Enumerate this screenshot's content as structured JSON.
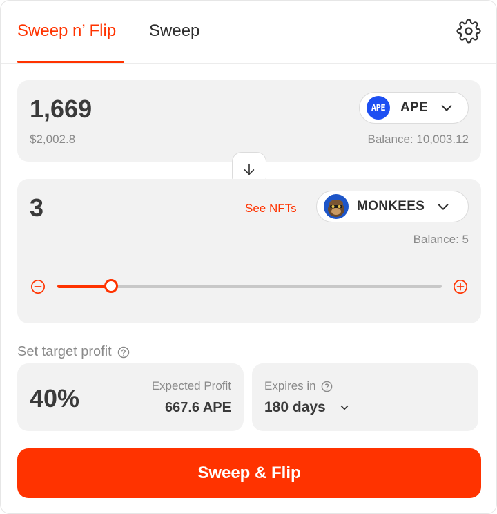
{
  "tabs": [
    {
      "label": "Sweep n’ Flip",
      "active": true
    },
    {
      "label": "Sweep",
      "active": false
    }
  ],
  "pay": {
    "amount": "1,669",
    "fiat": "$2,002.8",
    "token_symbol": "APE",
    "token_logo_text": "APE",
    "balance": "Balance: 10,003.12"
  },
  "receive": {
    "amount": "3",
    "see_nfts_label": "See NFTs",
    "token_symbol": "MONKEES",
    "balance": "Balance: 5",
    "slider_fraction": 0.14
  },
  "profit": {
    "section_label": "Set target profit",
    "percent": "40%",
    "expected_label": "Expected Profit",
    "expected_value": "667.6 APE"
  },
  "expiry": {
    "label": "Expires in",
    "value": "180 days"
  },
  "cta_label": "Sweep & Flip",
  "colors": {
    "accent": "#ff3300",
    "panel_bg": "#f2f2f2",
    "ape_blue": "#1d4ff2"
  },
  "icons": [
    "gear-icon",
    "chevron-down-icon",
    "arrow-down-icon",
    "minus-circle-icon",
    "plus-circle-icon",
    "help-circle-icon"
  ]
}
